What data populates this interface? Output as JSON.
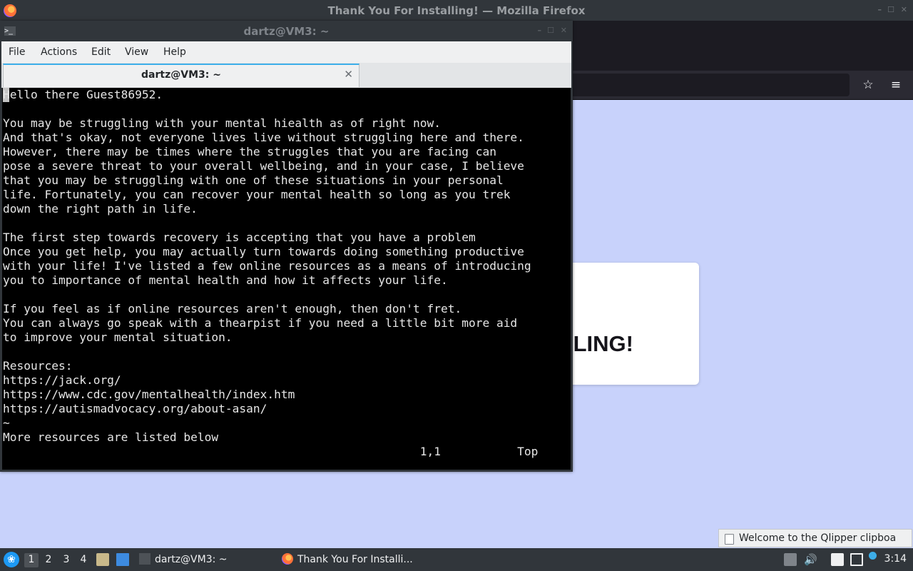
{
  "firefox": {
    "window_title": "Thank You For Installing! — Mozilla Firefox",
    "heading_fragment": "LING!",
    "bookmark_icon": "star-icon",
    "menu_icon": "hamburger-menu-icon"
  },
  "terminal": {
    "window_title": "dartz@VM3: ~",
    "menu": [
      "File",
      "Actions",
      "Edit",
      "View",
      "Help"
    ],
    "tab_label": "dartz@VM3: ~",
    "lines": [
      "Hello there Guest86952.",
      "",
      "You may be struggling with your mental hiealth as of right now.",
      "And that's okay, not everyone lives live without struggling here and there.",
      "However, there may be times where the struggles that you are facing can",
      "pose a severe threat to your overall wellbeing, and in your case, I believe",
      "that you may be struggling with one of these situations in your personal",
      "life. Fortunately, you can recover your mental health so long as you trek",
      "down the right path in life.",
      "",
      "The first step towards recovery is accepting that you have a problem",
      "Once you get help, you may actually turn towards doing something productive",
      "with your life! I've listed a few online resources as a means of introducing",
      "you to importance of mental health and how it affects your life.",
      "",
      "If you feel as if online resources aren't enough, then don't fret.",
      "You can always go speak with a thearpist if you need a little bit more aid",
      "to improve your mental situation.",
      "",
      "Resources:",
      "https://jack.org/",
      "https://www.cdc.gov/mentalhealth/index.htm",
      "https://autismadvocacy.org/about-asan/",
      "~",
      "More resources are listed below",
      "                                                            1,1           Top"
    ]
  },
  "taskbar": {
    "desktops": [
      "1",
      "2",
      "3",
      "4"
    ],
    "active_desktop": "1",
    "tasks": [
      {
        "label": "dartz@VM3: ~",
        "icon": "terminal-icon"
      },
      {
        "label": "Thank You For Installi...",
        "icon": "firefox-icon"
      }
    ],
    "clock": "3:14"
  },
  "notification": {
    "text": "Welcome to the Qlipper clipboa"
  },
  "colors": {
    "page_background": "#c8d2fb",
    "accent": "#3daee9",
    "terminal_bg": "#000000",
    "panel": "#31363b"
  }
}
